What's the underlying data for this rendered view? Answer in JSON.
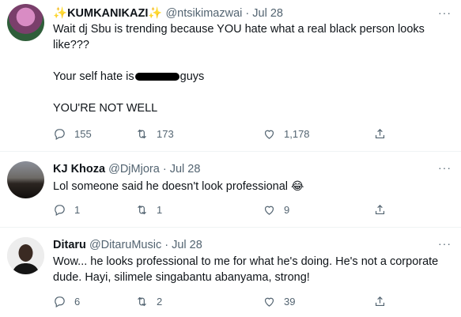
{
  "tweets": [
    {
      "name_sparkle_left": "✨",
      "name": "KUMKANIKAZI",
      "name_sparkle_right": "✨",
      "handle": "@ntsikimazwai",
      "dot": "·",
      "date": "Jul 28",
      "more": "···",
      "text_line1": "Wait dj Sbu is trending because YOU hate what a real black person looks like???",
      "text_line2_before": "Your self hate is",
      "text_line2_after": "guys",
      "text_line3": "YOU'RE NOT WELL",
      "replies": "155",
      "retweets": "173",
      "likes": "1,178"
    },
    {
      "name": "KJ Khoza",
      "handle": "@DjMjora",
      "dot": "·",
      "date": "Jul 28",
      "more": "···",
      "text": "Lol someone said he doesn't look professional",
      "emoji": "😂",
      "replies": "1",
      "retweets": "1",
      "likes": "9"
    },
    {
      "name": "Ditaru",
      "handle": "@DitaruMusic",
      "dot": "·",
      "date": "Jul 28",
      "more": "···",
      "text": "Wow... he looks professional to me  for what he's doing. He's not a corporate dude. Hayi, silimele singabantu abanyama, strong!",
      "replies": "6",
      "retweets": "2",
      "likes": "39"
    }
  ],
  "icons": {
    "reply": "reply-icon",
    "retweet": "retweet-icon",
    "like": "like-icon",
    "share": "share-icon"
  },
  "colors": {
    "text": "#0f1419",
    "secondary": "#536471",
    "divider": "#eff3f4",
    "sparkle": "#f4b400"
  }
}
